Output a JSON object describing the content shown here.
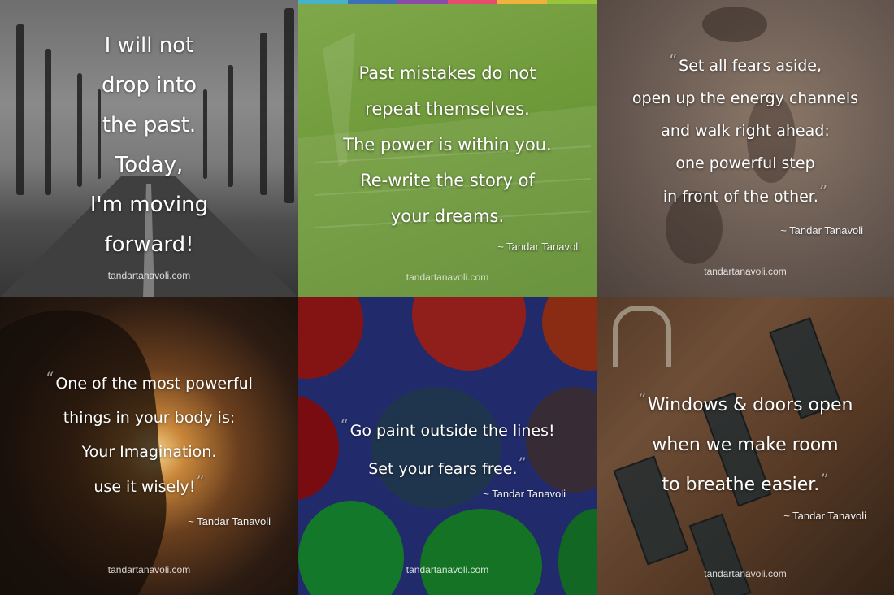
{
  "site": "tandartanavoli.com",
  "author": "~ Tandar Tanavoli",
  "colors": {
    "tile2_bar": [
      "#46b3c8",
      "#3d6fb8",
      "#8a4aa8",
      "#e64c6c",
      "#f0b23a",
      "#9ac43a"
    ]
  },
  "tiles": [
    {
      "lines": [
        "I will not",
        "drop into",
        "the past.",
        "Today,",
        "I'm moving",
        "forward!"
      ],
      "has_author": false,
      "has_quotes": false
    },
    {
      "lines": [
        "Past mistakes do not",
        "repeat themselves.",
        "The power is within you.",
        "Re-write the story of",
        "your dreams."
      ],
      "has_author": true,
      "has_quotes": false
    },
    {
      "lines": [
        "Set all fears aside,",
        "open up the energy channels",
        "and walk right ahead:",
        "one powerful step",
        "in front of the other."
      ],
      "has_author": true,
      "has_quotes": true
    },
    {
      "lines": [
        "One of the most powerful",
        "things in your body is:",
        "Your Imagination.",
        "use it wisely!"
      ],
      "has_author": true,
      "has_quotes": true
    },
    {
      "lines": [
        "Go paint outside the lines!",
        "Set your fears free."
      ],
      "has_author": true,
      "has_quotes": true
    },
    {
      "lines": [
        "Windows & doors open",
        "when we make room",
        "to breathe easier."
      ],
      "has_author": true,
      "has_quotes": true
    }
  ]
}
